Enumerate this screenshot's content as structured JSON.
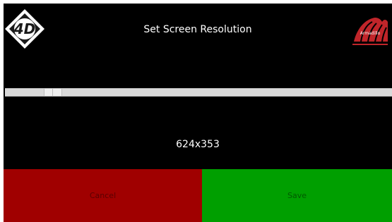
{
  "header": {
    "title": "Set Screen Resolution",
    "left_logo": "4d-systems-logo",
    "right_logo": "armadillo-logo",
    "right_logo_text": "Armadillo"
  },
  "slider": {
    "value_fraction": 0.1
  },
  "resolution_readout": "624x353",
  "buttons": {
    "cancel_label": "Cancel",
    "save_label": "Save"
  },
  "colors": {
    "background": "#000000",
    "cancel": "#a00000",
    "save": "#009f00",
    "slider_track": "#d9d9d9",
    "brand_red": "#c0252a"
  }
}
